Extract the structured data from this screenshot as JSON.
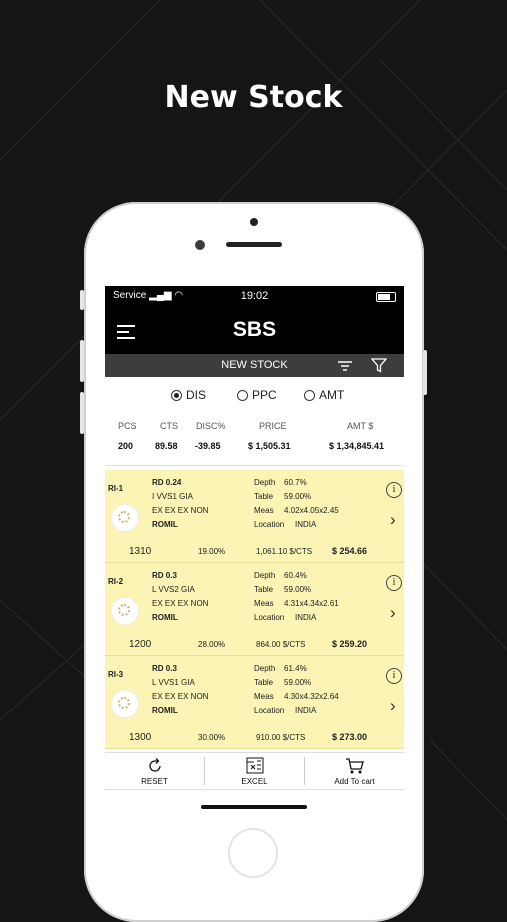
{
  "headline": "New Stock",
  "status": {
    "carrier": "Service",
    "time": "19:02"
  },
  "app": {
    "title": "SBS",
    "subtitle": "NEW STOCK"
  },
  "radio_options": [
    {
      "label": "DIS",
      "selected": true
    },
    {
      "label": "PPC",
      "selected": false
    },
    {
      "label": "AMT",
      "selected": false
    }
  ],
  "summary": {
    "headers": [
      "PCS",
      "CTS",
      "DISC%",
      "PRICE",
      "AMT $"
    ],
    "values": [
      "200",
      "89.58",
      "-39.85",
      "$ 1,505.31",
      "$ 1,34,845.41"
    ]
  },
  "items": [
    {
      "id": "RI-1",
      "line1": "RD  0.24",
      "line2": "I  VVS1  GIA",
      "line3": "EX  EX  EX  NON",
      "line4": "ROMIL",
      "depth_label": "Depth",
      "depth": "60.7%",
      "table_label": "Table",
      "table": "59.00%",
      "meas_label": "Meas",
      "meas": "4.02x4.05x2.45",
      "location_label": "Location",
      "location": "INDIA",
      "pcs": "1310",
      "disc": "19.00%",
      "ppc": "1,061.10 $/CTS",
      "amt": "$  254.66"
    },
    {
      "id": "RI-2",
      "line1": "RD  0.3",
      "line2": "L  VVS2  GIA",
      "line3": "EX  EX  EX  NON",
      "line4": "ROMIL",
      "depth_label": "Depth",
      "depth": "60.4%",
      "table_label": "Table",
      "table": "59.00%",
      "meas_label": "Meas",
      "meas": "4.31x4.34x2.61",
      "location_label": "Location",
      "location": "INDIA",
      "pcs": "1200",
      "disc": "28.00%",
      "ppc": "864.00 $/CTS",
      "amt": "$  259.20"
    },
    {
      "id": "RI-3",
      "line1": "RD  0.3",
      "line2": "L  VVS1  GIA",
      "line3": "EX  EX  EX  NON",
      "line4": "ROMIL",
      "depth_label": "Depth",
      "depth": "61.4%",
      "table_label": "Table",
      "table": "59.00%",
      "meas_label": "Meas",
      "meas": "4.30x4.32x2.64",
      "location_label": "Location",
      "location": "INDIA",
      "pcs": "1300",
      "disc": "30.00%",
      "ppc": "910.00 $/CTS",
      "amt": "$  273.00"
    }
  ],
  "bottom": {
    "reset": "RESET",
    "excel": "EXCEL",
    "cart": "Add To cart"
  },
  "colors": {
    "card_bg": "#fbf4b4",
    "navbar": "#000000",
    "subbar": "#3d3d3d",
    "background": "#151515"
  }
}
